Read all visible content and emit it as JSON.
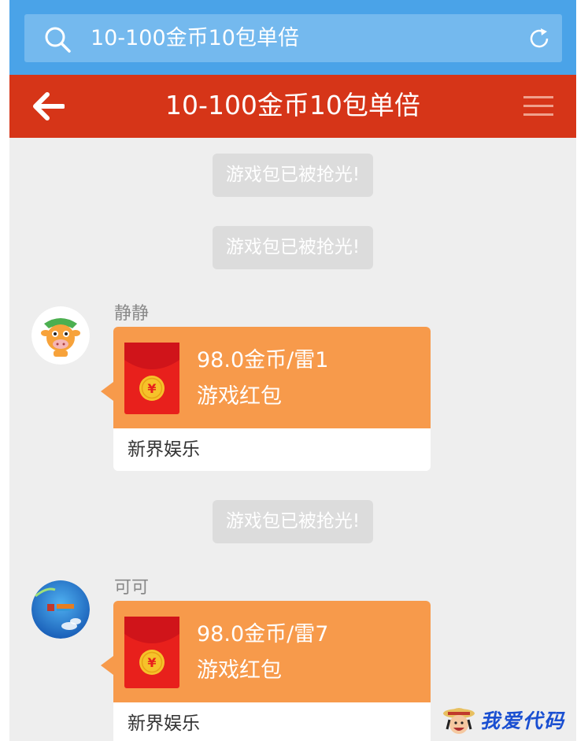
{
  "browser": {
    "search_text": "10-100金币10包单倍",
    "bar_color": "#4aa3e8"
  },
  "header": {
    "title": "10-100金币10包单倍",
    "color": "#d63518"
  },
  "system_messages": [
    "游戏包已被抢光!",
    "游戏包已被抢光!",
    "游戏包已被抢光!"
  ],
  "messages": [
    {
      "sender": "静静",
      "amount": "98.0金币/雷1",
      "type": "游戏红包",
      "source": "新界娱乐"
    },
    {
      "sender": "可可",
      "amount": "98.0金币/雷7",
      "type": "游戏红包",
      "source": "新界娱乐"
    }
  ],
  "watermark": {
    "text": "我爱代码"
  },
  "colors": {
    "packet": "#f79a4b",
    "envelope": "#e8201c",
    "coin": "#f6c22a",
    "chat_bg": "#eeeeee"
  }
}
